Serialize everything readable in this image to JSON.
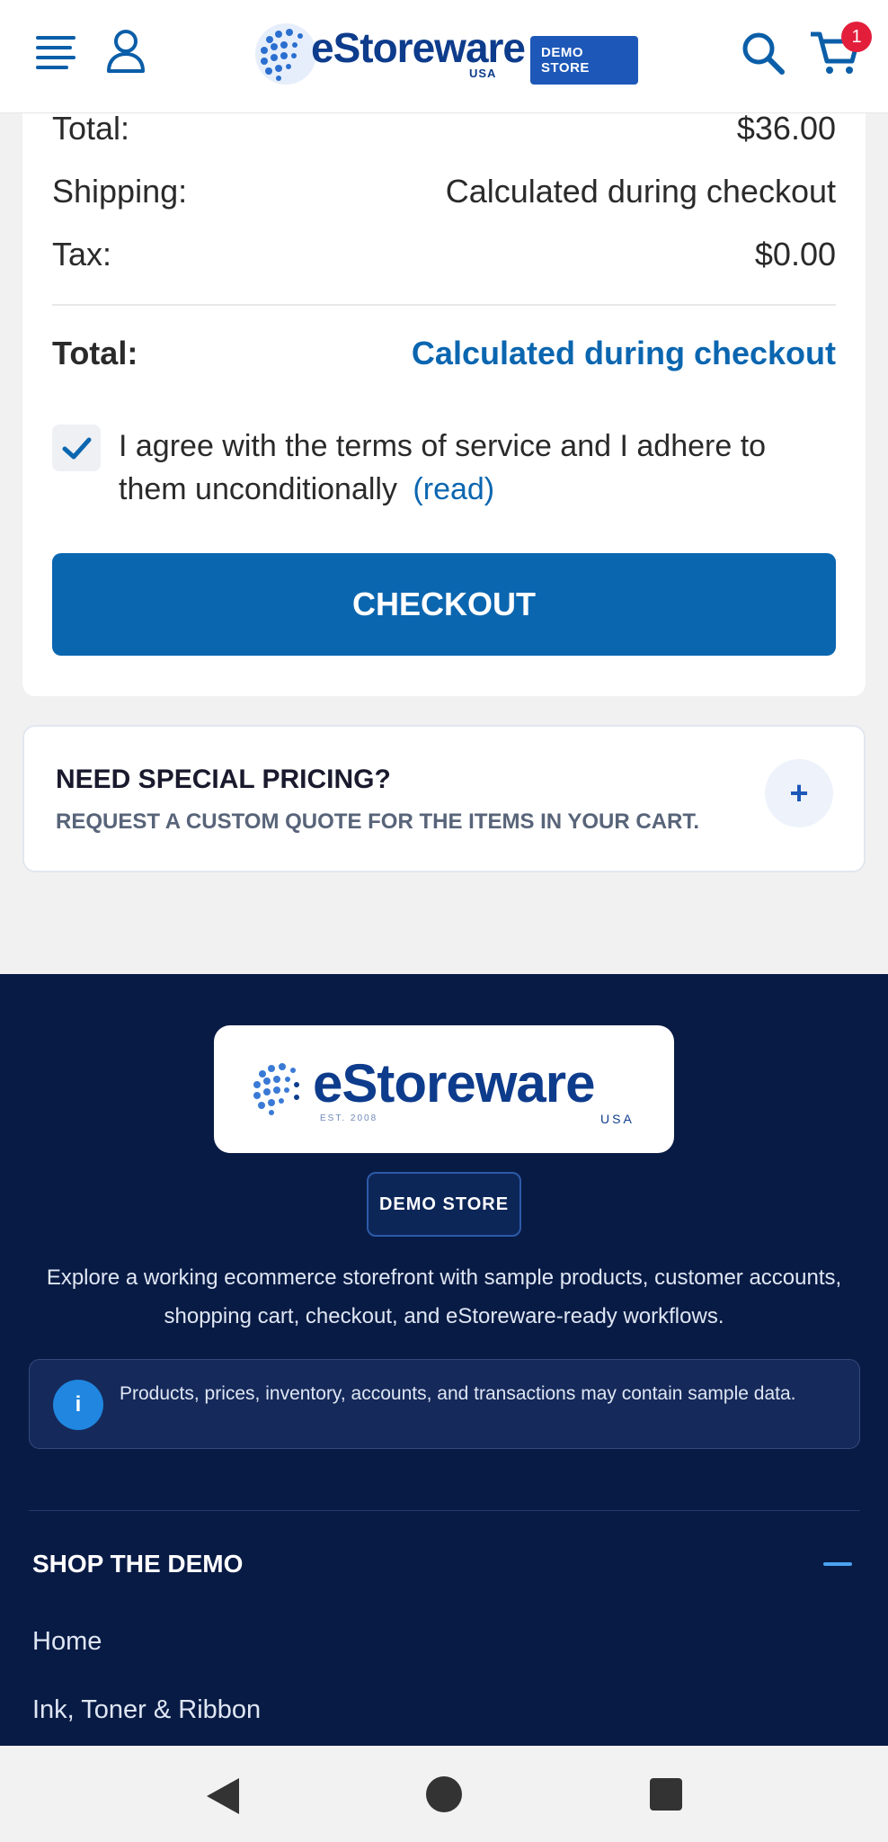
{
  "header": {
    "logo_text": "eStoreware",
    "logo_sub": "USA",
    "demo_badge": "DEMO STORE",
    "cart_count": "1"
  },
  "summary": {
    "subtotal_label": "Total:",
    "subtotal_value": "$36.00",
    "shipping_label": "Shipping:",
    "shipping_value": "Calculated during checkout",
    "tax_label": "Tax:",
    "tax_value": "$0.00",
    "total_label": "Total:",
    "total_value": "Calculated during checkout",
    "agree_text": "I agree with the terms of service and I adhere to them unconditionally",
    "read_link": "(read)",
    "checkbox_checked": true,
    "checkout_label": "CHECKOUT"
  },
  "pricing": {
    "title": "NEED SPECIAL PRICING?",
    "subtitle": "REQUEST A CUSTOM QUOTE FOR THE ITEMS IN YOUR CART.",
    "toggle": "+"
  },
  "footer": {
    "logo_text": "eStoreware",
    "logo_est": "EST. 2008",
    "logo_sub": "USA",
    "demo_badge": "DEMO STORE",
    "description": "Explore a working ecommerce storefront with sample products, customer accounts, shopping cart, checkout, and eStoreware-ready workflows.",
    "notice_icon": "i",
    "notice": "Products, prices, inventory, accounts, and transactions may contain sample data.",
    "shop_title": "SHOP THE DEMO",
    "links": [
      "Home",
      "Ink, Toner & Ribbon"
    ]
  },
  "colors": {
    "accent": "#0b66b0",
    "footer_bg": "#081b45",
    "badge": "#e31e3b"
  }
}
